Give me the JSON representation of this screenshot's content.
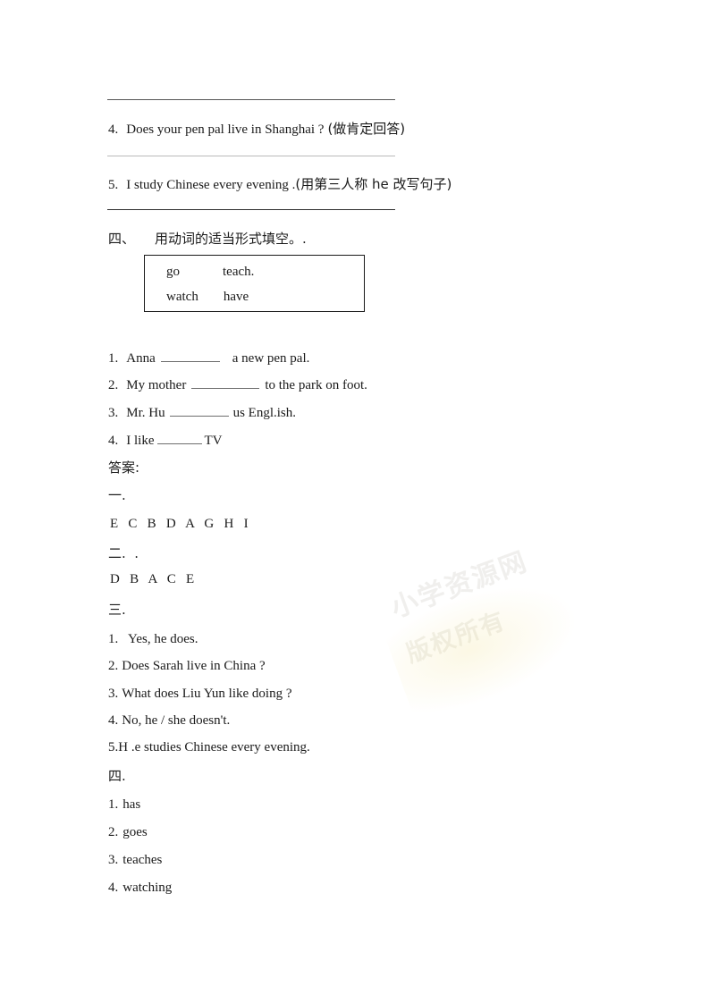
{
  "document": {
    "rewrite_section": {
      "items": [
        {
          "number": "4.",
          "english": "Does your pen pal live in Shanghai ?",
          "instruction": "(做肯定回答)"
        },
        {
          "number": "5.",
          "english": "I study Chinese every evening .",
          "instruction": "(用第三人称 he 改写句子)"
        }
      ]
    },
    "section_four": {
      "marker": "四、",
      "title": "用动词的适当形式填空。.",
      "word_bank": {
        "row1": [
          "go",
          "teach."
        ],
        "row2": [
          "watch",
          "have"
        ]
      },
      "questions": [
        {
          "number": "1.",
          "before": "Anna",
          "after": "a new pen pal.",
          "blank_width": 66
        },
        {
          "number": "2.",
          "before": "My mother",
          "after": "to the park on foot.",
          "blank_width": 76
        },
        {
          "number": "3.",
          "before": "Mr. Hu",
          "after": "us Engl.ish.",
          "blank_width": 66
        },
        {
          "number": "4.",
          "before": "I like",
          "after": "TV",
          "blank_width": 50
        }
      ]
    },
    "answer_key": {
      "heading": "答案:",
      "part_one": {
        "marker": "一.",
        "letters": "E   C   B   D   A   G   H   I"
      },
      "part_two": {
        "marker": "二.  .",
        "letters": "D   B   A   C   E"
      },
      "part_three": {
        "marker": "三.",
        "items": [
          {
            "number": "1.",
            "text": "Yes, he does."
          },
          {
            "number": "2.",
            "text": "Does Sarah live in China ?"
          },
          {
            "number": "3.",
            "text": "What does Liu Yun like doing ?"
          },
          {
            "number": "4.",
            "text": "No, he / she doesn't."
          },
          {
            "number": "5.",
            "text": "H .e studies Chinese every evening."
          }
        ]
      },
      "part_four": {
        "marker": "四.",
        "items": [
          {
            "number": "1.",
            "text": "has"
          },
          {
            "number": "2.",
            "text": "goes"
          },
          {
            "number": "3.",
            "text": "teaches"
          },
          {
            "number": "4.",
            "text": "watching"
          }
        ]
      }
    },
    "watermark": {
      "line1": "小学资源网",
      "line2": "版权所有"
    }
  }
}
